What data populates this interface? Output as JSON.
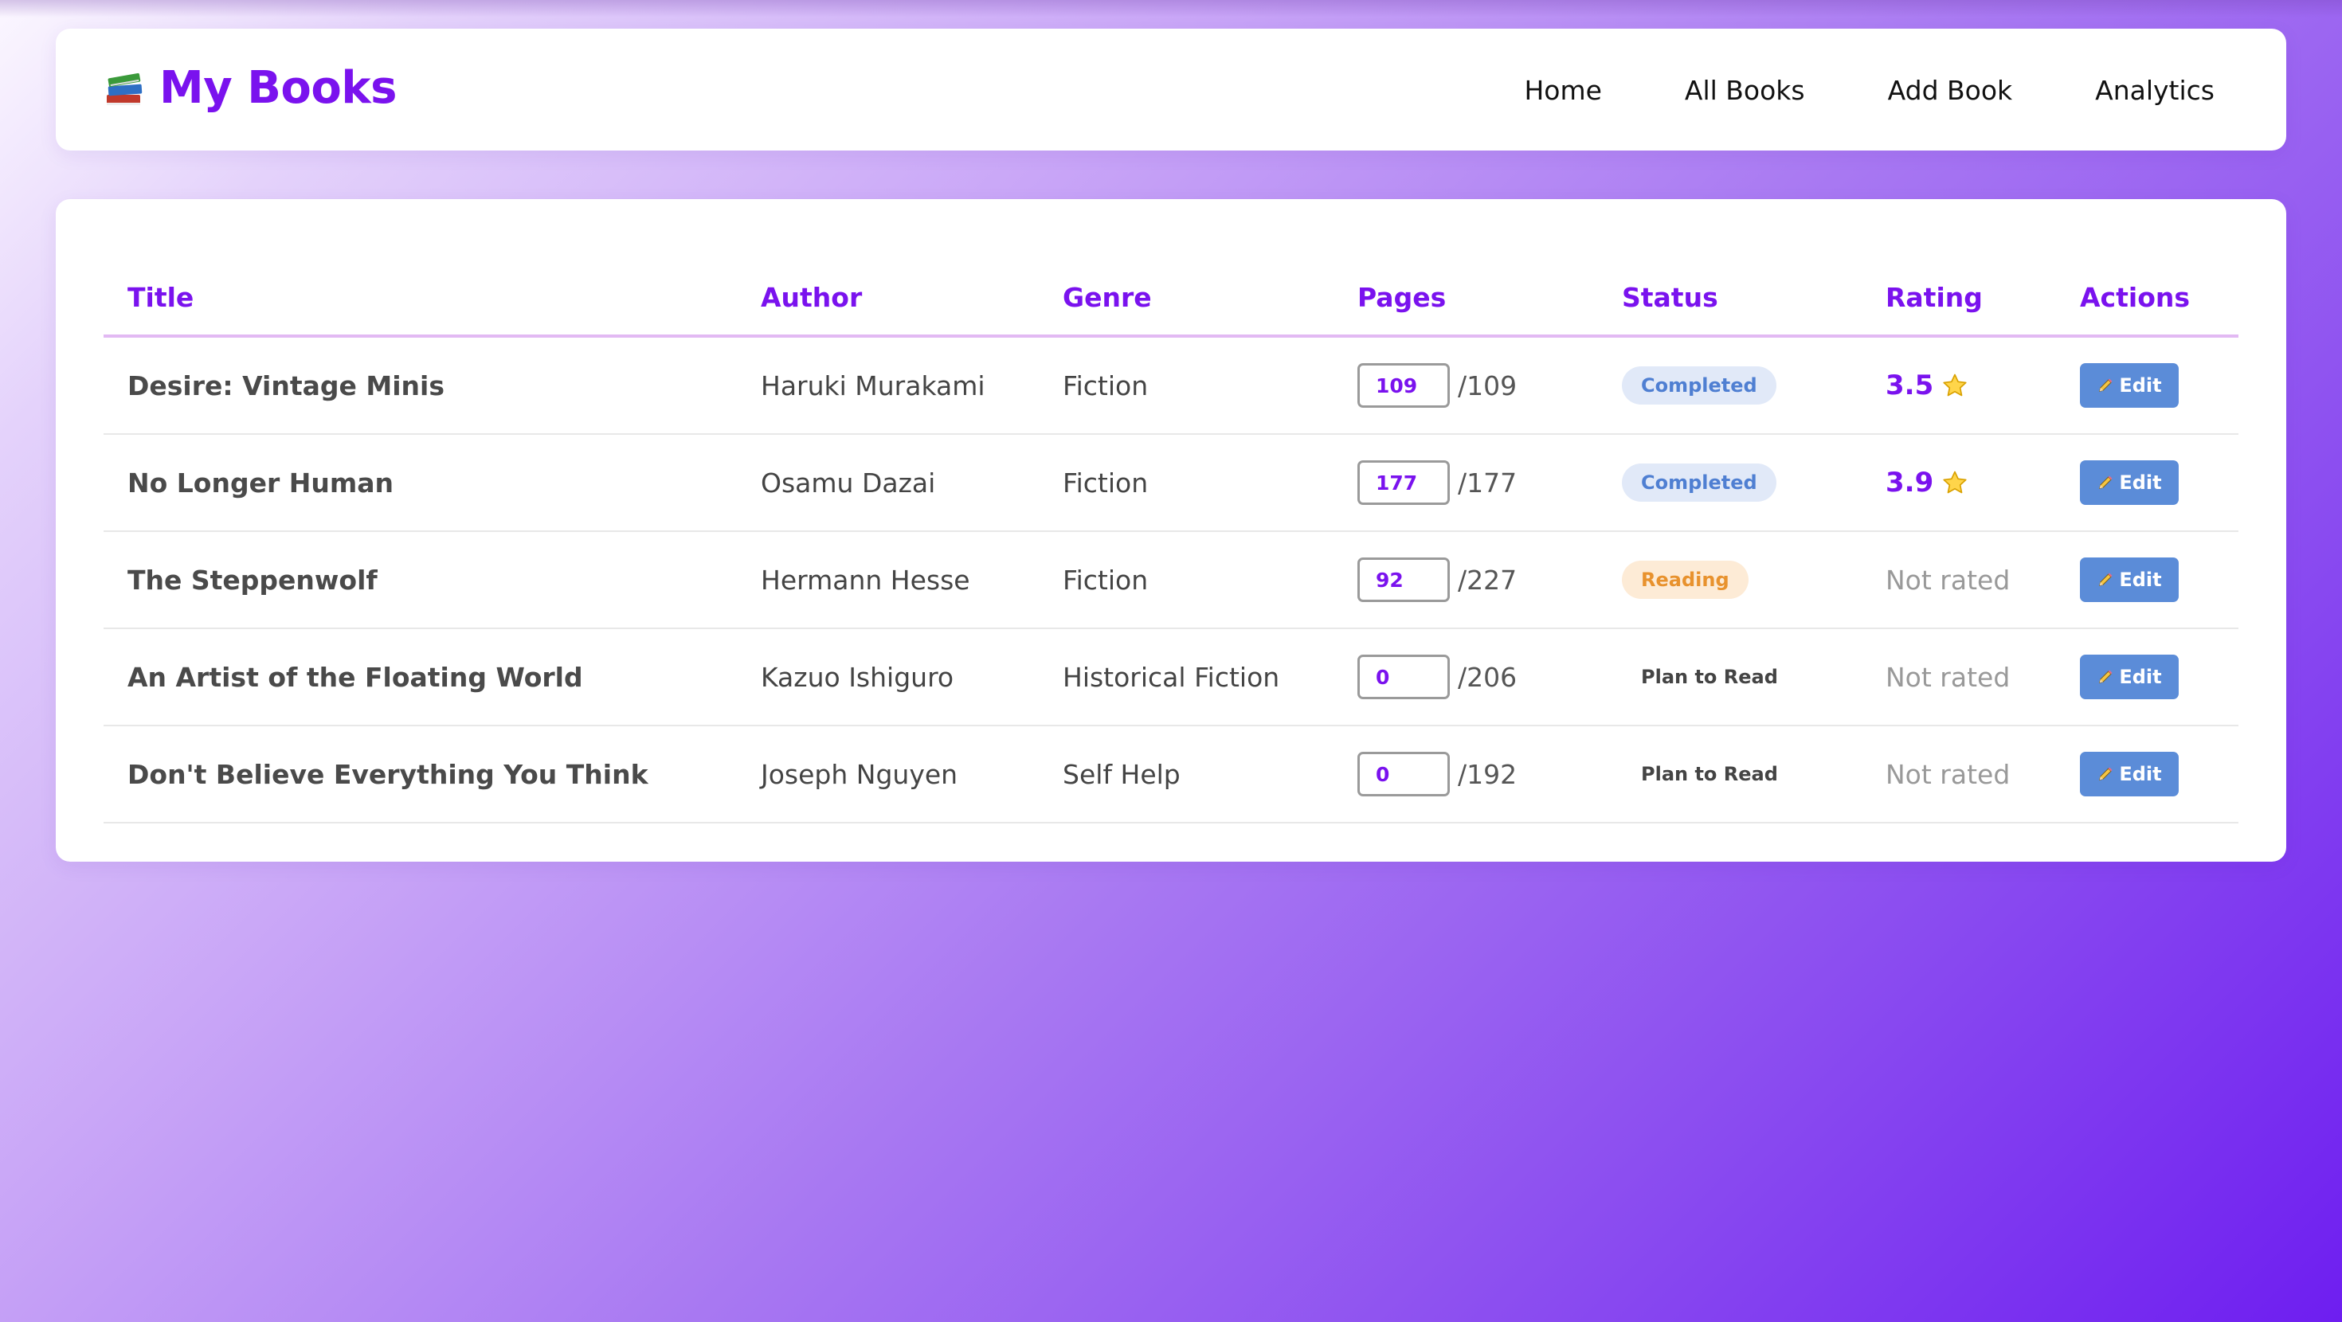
{
  "header": {
    "logo_icon": "books-stack-icon",
    "title": "My Books",
    "nav": [
      "Home",
      "All Books",
      "Add Book",
      "Analytics"
    ]
  },
  "table": {
    "columns": [
      "Title",
      "Author",
      "Genre",
      "Pages",
      "Status",
      "Rating",
      "Actions"
    ],
    "rows": [
      {
        "title": "Desire: Vintage Minis",
        "author": "Haruki Murakami",
        "genre": "Fiction",
        "pages_read": "109",
        "pages_total": "/109",
        "status": "Completed",
        "status_kind": "completed",
        "rating": "3.5",
        "rated": true,
        "action": "Edit"
      },
      {
        "title": "No Longer Human",
        "author": "Osamu Dazai",
        "genre": "Fiction",
        "pages_read": "177",
        "pages_total": "/177",
        "status": "Completed",
        "status_kind": "completed",
        "rating": "3.9",
        "rated": true,
        "action": "Edit"
      },
      {
        "title": "The Steppenwolf",
        "author": "Hermann Hesse",
        "genre": "Fiction",
        "pages_read": "92",
        "pages_total": "/227",
        "status": "Reading",
        "status_kind": "reading",
        "rating": "Not rated",
        "rated": false,
        "action": "Edit"
      },
      {
        "title": "An Artist of the Floating World",
        "author": "Kazuo Ishiguro",
        "genre": "Historical Fiction",
        "pages_read": "0",
        "pages_total": "/206",
        "status": "Plan to Read",
        "status_kind": "plan",
        "rating": "Not rated",
        "rated": false,
        "action": "Edit"
      },
      {
        "title": "Don't Believe Everything You Think",
        "author": "Joseph Nguyen",
        "genre": "Self Help",
        "pages_read": "0",
        "pages_total": "/192",
        "status": "Plan to Read",
        "status_kind": "plan",
        "rating": "Not rated",
        "rated": false,
        "action": "Edit"
      }
    ]
  },
  "colors": {
    "accent": "#7a12ee",
    "completed_bg": "#e1e9f8",
    "completed_fg": "#4f7fd2",
    "reading_bg": "#fdebd6",
    "reading_fg": "#e8922e",
    "edit_button": "#5b8cd8"
  },
  "icons": {
    "rating": "star-icon",
    "edit": "pencil-icon"
  }
}
